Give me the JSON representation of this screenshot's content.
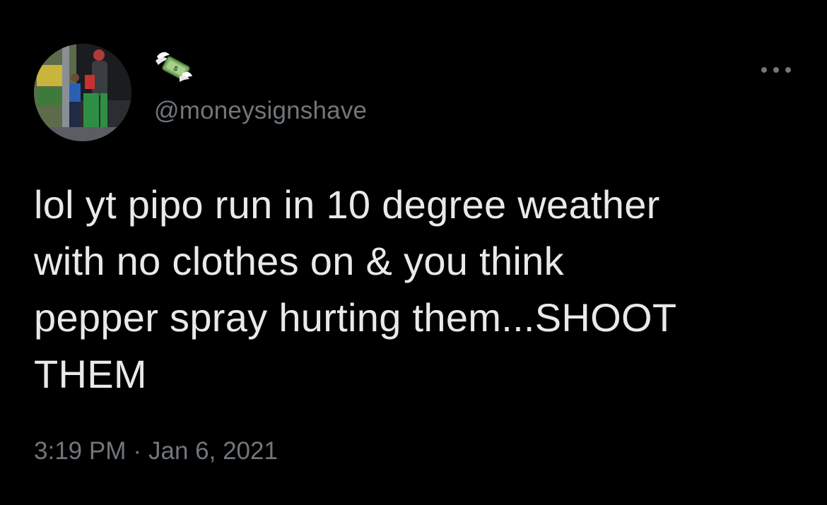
{
  "tweet": {
    "author": {
      "display_name_icon": "money-with-wings-icon",
      "handle": "@moneysignshave",
      "avatar": "avatar-photo"
    },
    "text": "lol yt pipo run in 10 degree weather\nwith no clothes on & you think\npepper spray hurting them...SHOOT\nTHEM",
    "time": "3:19 PM",
    "separator": "·",
    "date": "Jan 6, 2021",
    "more_icon": "more-options-icon"
  },
  "colors": {
    "background": "#000000",
    "primary_text": "#e7e9ea",
    "secondary_text": "#71767b"
  }
}
